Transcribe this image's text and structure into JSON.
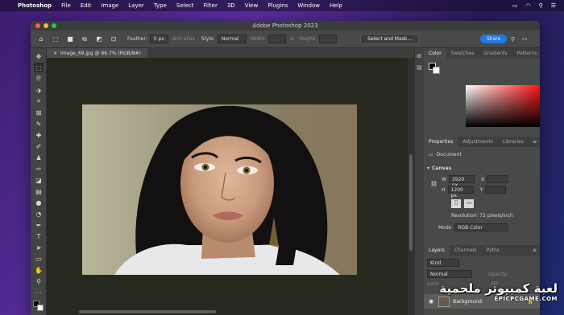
{
  "menubar": {
    "app": "Photoshop",
    "items": [
      "File",
      "Edit",
      "Image",
      "Layer",
      "Type",
      "Select",
      "Filter",
      "3D",
      "View",
      "Plugins",
      "Window",
      "Help"
    ]
  },
  "window": {
    "title": "Adobe Photoshop 2023"
  },
  "options": {
    "feather_label": "Feather:",
    "feather_value": "0 px",
    "antialias_label": "Anti-alias",
    "style_label": "Style:",
    "style_value": "Normal",
    "width_label": "Width:",
    "height_label": "Height:",
    "select_mask": "Select and Mask...",
    "share": "Share"
  },
  "document": {
    "tab_label": "Image_69.jpg @ 66.7% (RGB/8#)"
  },
  "color_panel": {
    "tabs": [
      "Color",
      "Swatches",
      "Gradients",
      "Patterns"
    ]
  },
  "properties_panel": {
    "tabs": [
      "Properties",
      "Adjustments",
      "Libraries"
    ],
    "doc_label": "Document",
    "canvas_label": "Canvas",
    "w_label": "W",
    "w_value": "1920 px",
    "h_label": "H",
    "h_value": "1200 px",
    "x_label": "X",
    "y_label": "Y",
    "resolution": "Resolution: 72 pixels/inch",
    "mode_label": "Mode",
    "mode_value": "RGB Color"
  },
  "layers_panel": {
    "tabs": [
      "Layers",
      "Channels",
      "Paths"
    ],
    "kind_label": "Kind",
    "blend_mode": "Normal",
    "opacity_label": "Opacity:",
    "lock_label": "Lock:",
    "fill_label": "Fill:",
    "layer_name": "Background"
  },
  "watermark": {
    "arabic": "لعبة كمبيوتر ملحمية",
    "domain": "EPICPCGAME.COM"
  },
  "colors": {
    "accent": "#1e78e8",
    "canvas_bg": "#27291f",
    "panel_bg": "#474a47"
  }
}
